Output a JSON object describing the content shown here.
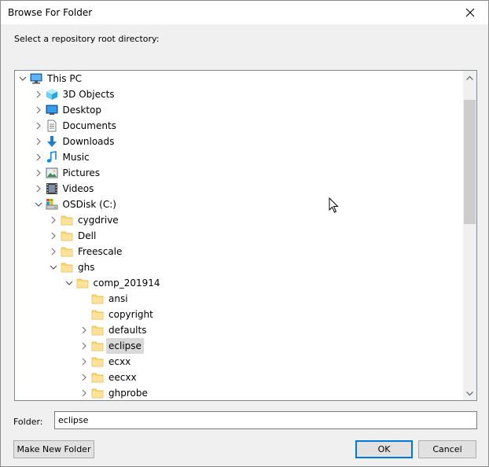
{
  "window": {
    "title": "Browse For Folder",
    "prompt": "Select a repository root directory:"
  },
  "tree": {
    "nodes": [
      {
        "label": "This PC",
        "depth": 0,
        "expander": "expanded",
        "icon": "computer-icon"
      },
      {
        "label": "3D Objects",
        "depth": 1,
        "expander": "collapsed",
        "icon": "3d-objects-icon"
      },
      {
        "label": "Desktop",
        "depth": 1,
        "expander": "collapsed",
        "icon": "desktop-icon"
      },
      {
        "label": "Documents",
        "depth": 1,
        "expander": "collapsed",
        "icon": "documents-icon"
      },
      {
        "label": "Downloads",
        "depth": 1,
        "expander": "collapsed",
        "icon": "downloads-icon"
      },
      {
        "label": "Music",
        "depth": 1,
        "expander": "collapsed",
        "icon": "music-icon"
      },
      {
        "label": "Pictures",
        "depth": 1,
        "expander": "collapsed",
        "icon": "pictures-icon"
      },
      {
        "label": "Videos",
        "depth": 1,
        "expander": "collapsed",
        "icon": "videos-icon"
      },
      {
        "label": "OSDisk (C:)",
        "depth": 1,
        "expander": "expanded",
        "icon": "drive-icon"
      },
      {
        "label": "cygdrive",
        "depth": 2,
        "expander": "collapsed",
        "icon": "folder-icon"
      },
      {
        "label": "Dell",
        "depth": 2,
        "expander": "collapsed",
        "icon": "folder-icon"
      },
      {
        "label": "Freescale",
        "depth": 2,
        "expander": "collapsed",
        "icon": "folder-icon"
      },
      {
        "label": "ghs",
        "depth": 2,
        "expander": "expanded",
        "icon": "folder-icon"
      },
      {
        "label": "comp_201914",
        "depth": 3,
        "expander": "expanded",
        "icon": "folder-icon"
      },
      {
        "label": "ansi",
        "depth": 4,
        "expander": "none",
        "icon": "folder-icon"
      },
      {
        "label": "copyright",
        "depth": 4,
        "expander": "none",
        "icon": "folder-icon"
      },
      {
        "label": "defaults",
        "depth": 4,
        "expander": "collapsed",
        "icon": "folder-icon"
      },
      {
        "label": "eclipse",
        "depth": 4,
        "expander": "collapsed",
        "icon": "folder-icon",
        "selected": true
      },
      {
        "label": "ecxx",
        "depth": 4,
        "expander": "collapsed",
        "icon": "folder-icon"
      },
      {
        "label": "eecxx",
        "depth": 4,
        "expander": "collapsed",
        "icon": "folder-icon"
      },
      {
        "label": "ghprobe",
        "depth": 4,
        "expander": "collapsed",
        "icon": "folder-icon"
      }
    ],
    "scroll_position": 0.09,
    "scroll_visible_fraction": 0.41
  },
  "folder": {
    "label": "Folder:",
    "value": "eclipse"
  },
  "buttons": {
    "make_new_folder": "Make New Folder",
    "ok": "OK",
    "cancel": "Cancel"
  },
  "colors": {
    "accent": "#0078d7",
    "folder": "#ffd76e",
    "selection": "#d9d9d9"
  }
}
